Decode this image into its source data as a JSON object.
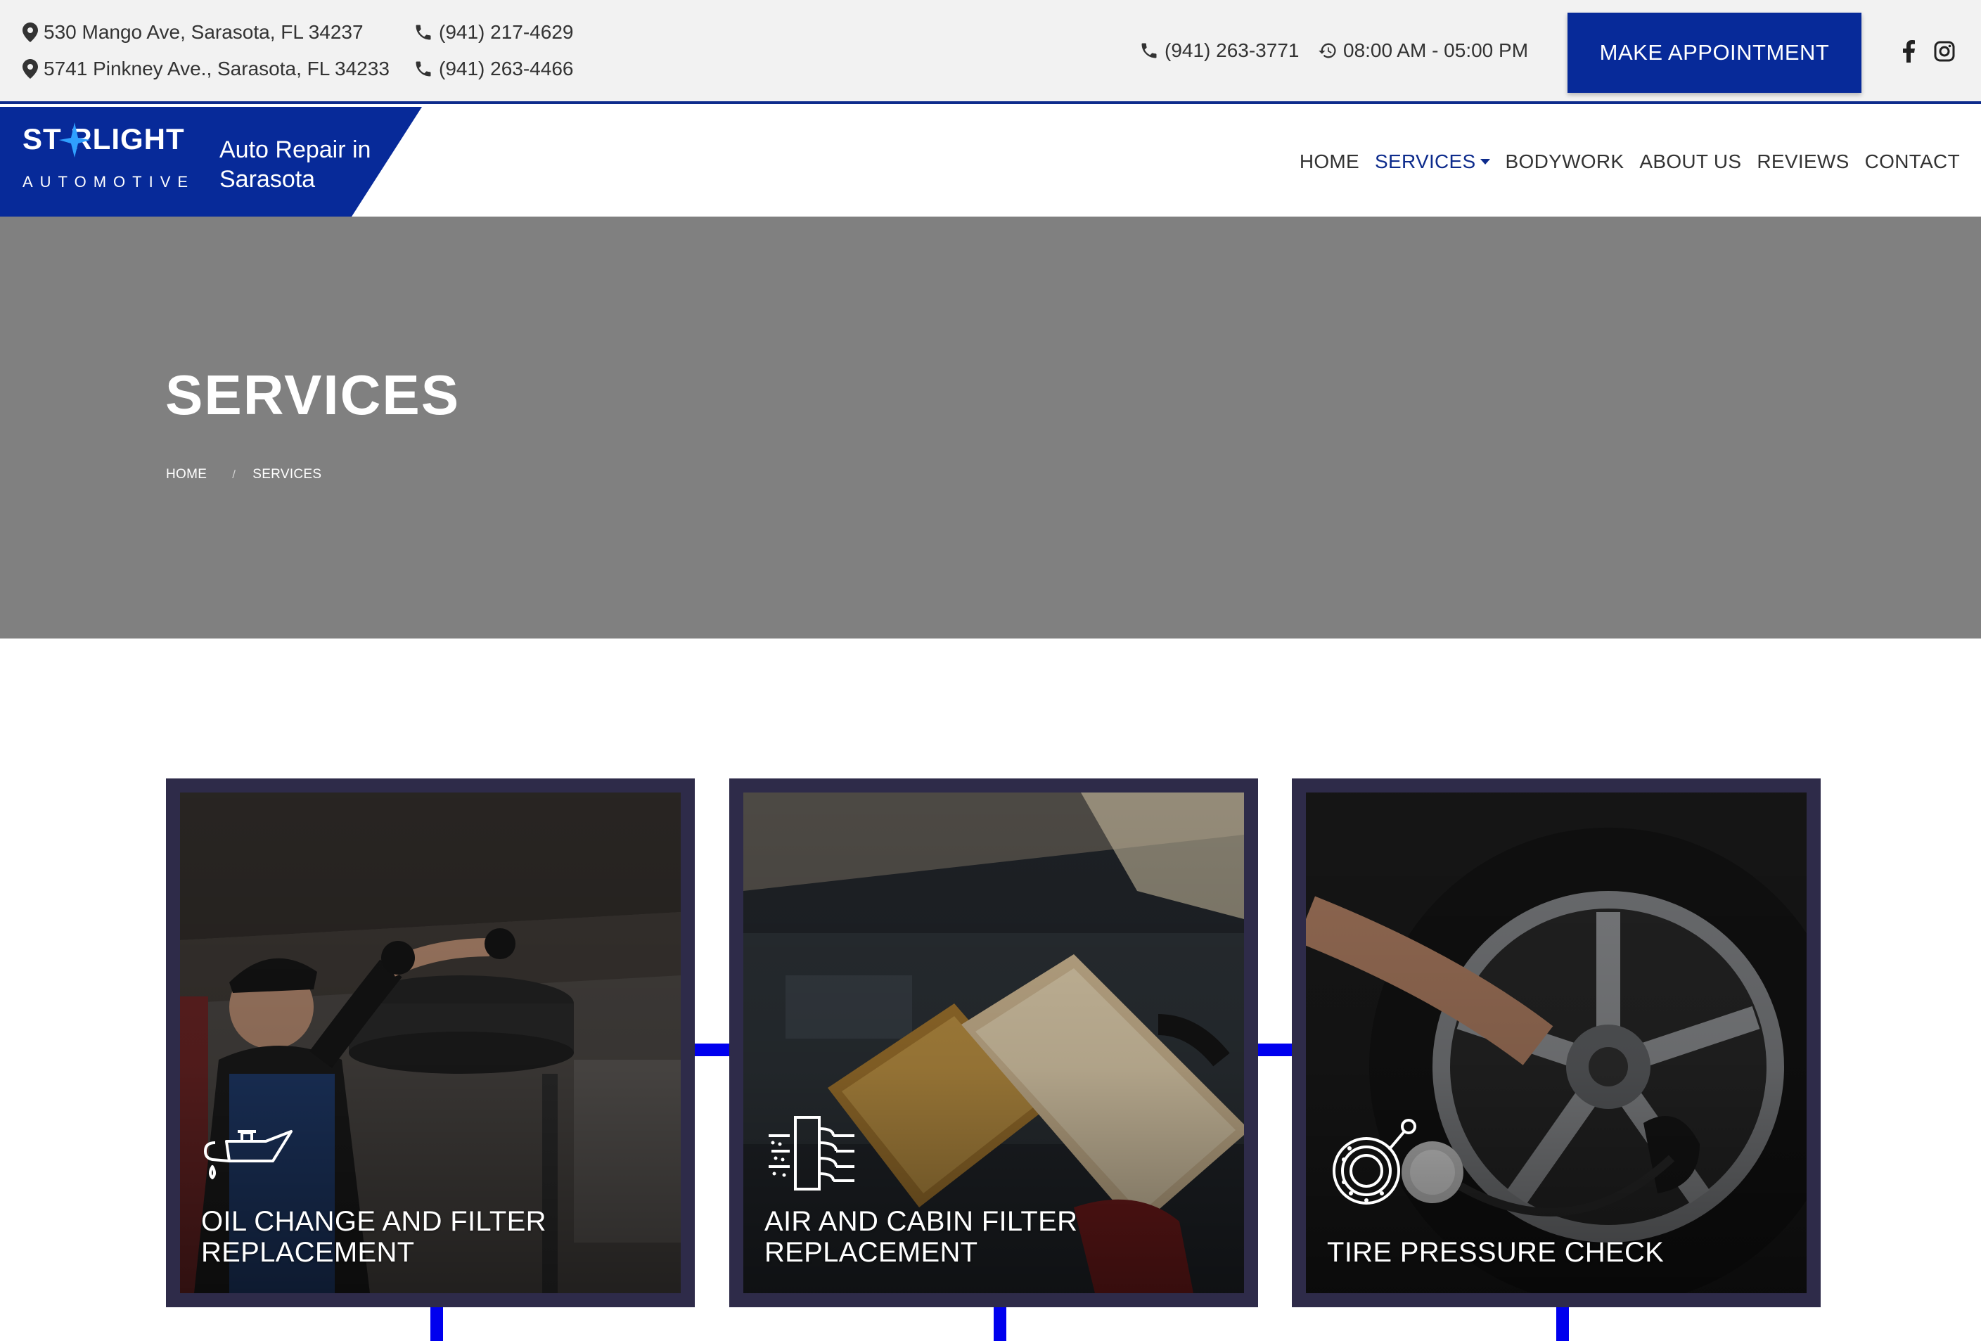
{
  "topbar": {
    "addresses": [
      "530 Mango Ave, Sarasota, FL 34237",
      "5741 Pinkney Ave., Sarasota, FL 34233"
    ],
    "phones": [
      "(941) 217-4629",
      "(941) 263-4466"
    ],
    "main_phone": "(941) 263-3771",
    "hours": "08:00 AM - 05:00 PM",
    "appointment_button": "MAKE APPOINTMENT",
    "social_icons": [
      "facebook-icon",
      "instagram-icon"
    ]
  },
  "header": {
    "logo_main": "ST RLIGHT",
    "logo_sub": "AUTOMOTIVE",
    "tagline": "Auto Repair in Sarasota",
    "nav": [
      "HOME",
      "SERVICES",
      "BODYWORK",
      "ABOUT US",
      "REVIEWS",
      "CONTACT"
    ],
    "active_nav": "SERVICES"
  },
  "hero": {
    "title": "SERVICES",
    "breadcrumb": [
      "HOME",
      "SERVICES"
    ],
    "separator": "/"
  },
  "services": [
    {
      "title": "OIL CHANGE AND FILTER REPLACEMENT",
      "icon": "oil-can-icon"
    },
    {
      "title": "AIR AND CABIN FILTER REPLACEMENT",
      "icon": "air-filter-icon"
    },
    {
      "title": "TIRE PRESSURE CHECK",
      "icon": "tire-gauge-icon"
    }
  ],
  "colors": {
    "brand_blue": "#072a99",
    "connector_blue": "#0000ee",
    "card_frame": "#2e2b49",
    "hero_gray": "#808080"
  }
}
